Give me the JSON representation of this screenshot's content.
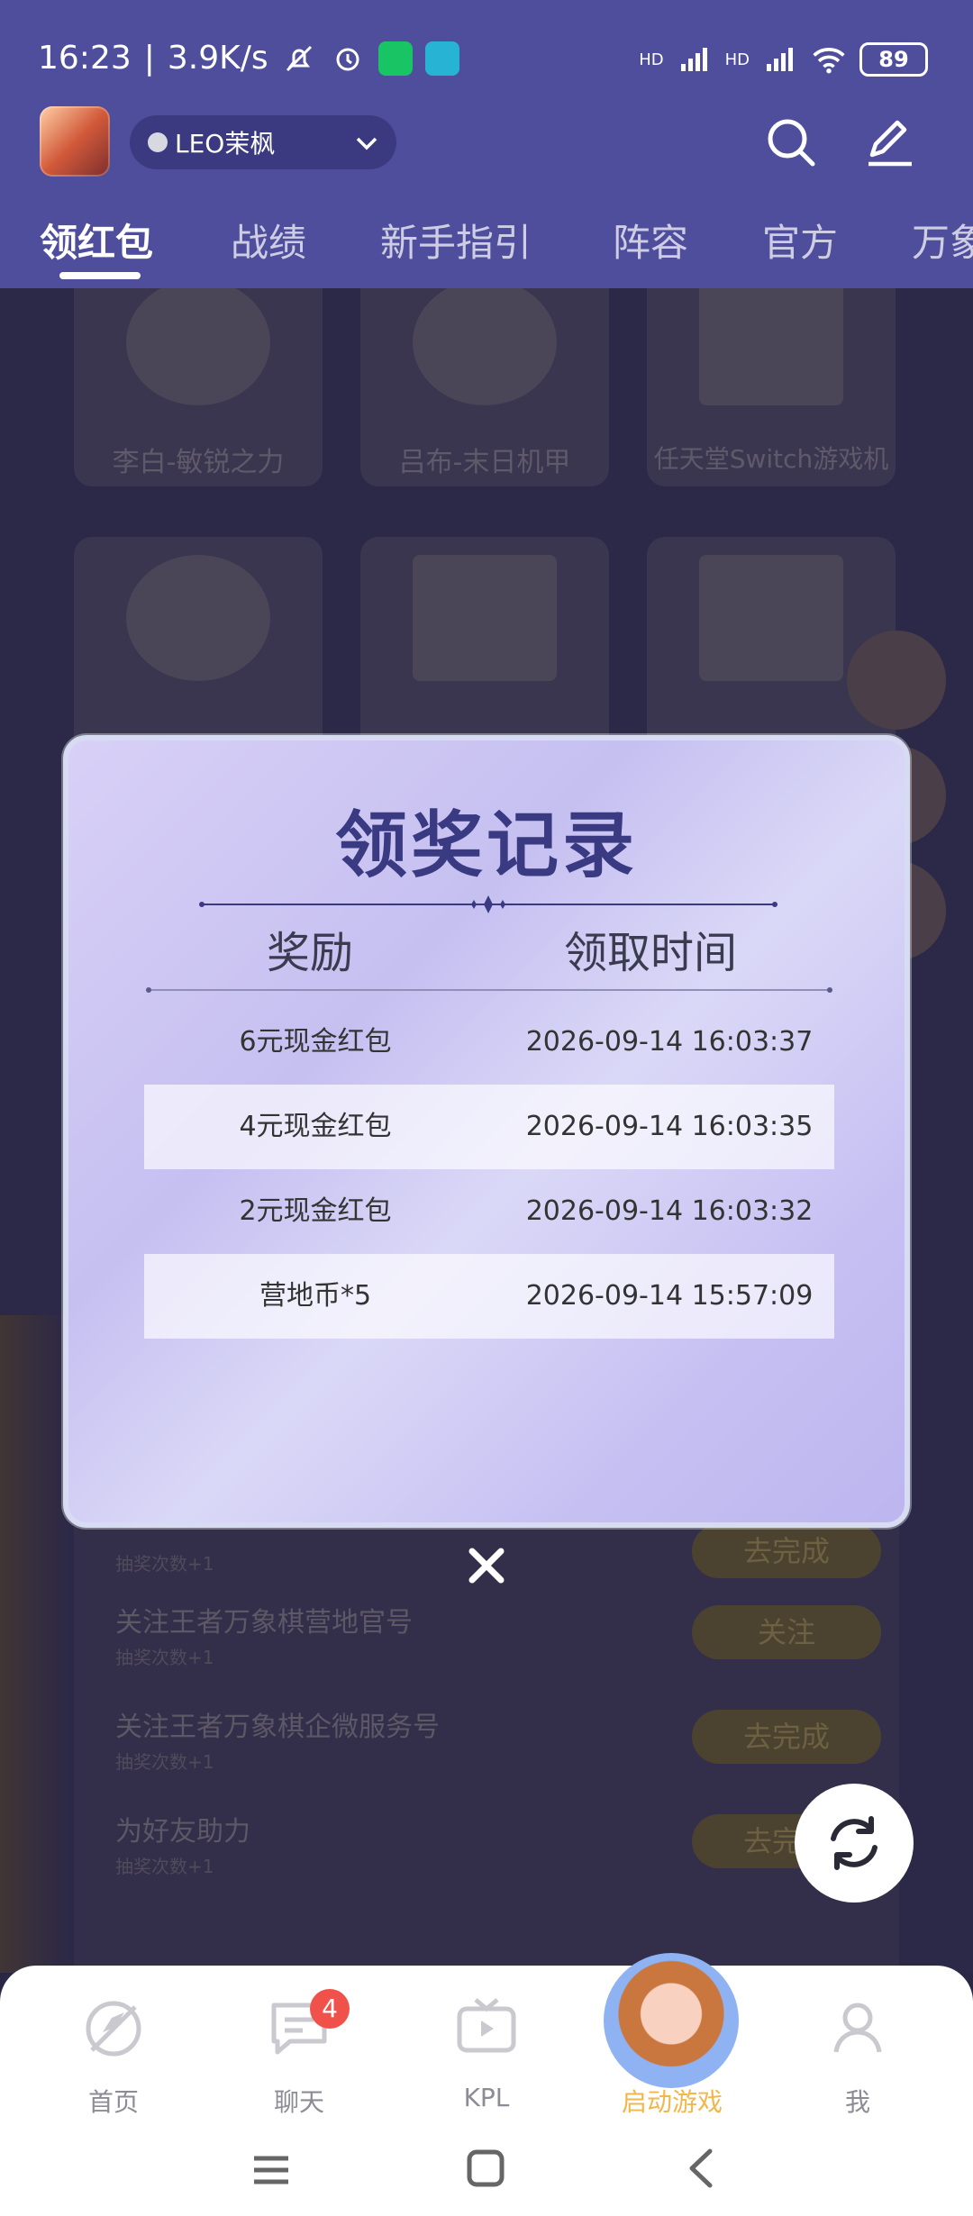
{
  "status_bar": {
    "time": "16:23",
    "network_speed": "3.9K/s",
    "battery": "89",
    "signal_label_1": "HD",
    "signal_label_2": "HD",
    "icons": [
      "mute-bell-icon",
      "alarm-icon",
      "wechat-icon",
      "telegram-icon",
      "signal-icon",
      "signal-icon",
      "wifi-icon",
      "battery-icon"
    ]
  },
  "app_bar": {
    "account_name": "LEO茉枫",
    "icons": [
      "search-icon",
      "edit-icon"
    ]
  },
  "tabs": [
    {
      "label": "领红包",
      "active": true
    },
    {
      "label": "战绩"
    },
    {
      "label": "新手指引"
    },
    {
      "label": "阵容"
    },
    {
      "label": "官方"
    },
    {
      "label": "万象"
    }
  ],
  "background": {
    "cards": [
      {
        "label": "李白-敏锐之力"
      },
      {
        "label": "吕布-末日机甲"
      },
      {
        "label": "任天堂Switch游戏机"
      }
    ],
    "tasks": [
      {
        "title": "",
        "sub": "抽奖次数+1",
        "button": "去完成"
      },
      {
        "title": "关注王者万象棋营地官号",
        "sub": "抽奖次数+1",
        "button": "关注"
      },
      {
        "title": "关注王者万象棋企微服务号",
        "sub": "抽奖次数+1",
        "button": "去完成"
      },
      {
        "title": "为好友助力",
        "sub": "抽奖次数+1",
        "button": "去完成"
      }
    ]
  },
  "modal": {
    "title": "领奖记录",
    "col_reward": "奖励",
    "col_time": "领取时间",
    "records": [
      {
        "reward": "6元现金红包",
        "time": "2026-09-14 16:03:37"
      },
      {
        "reward": "4元现金红包",
        "time": "2026-09-14 16:03:35"
      },
      {
        "reward": "2元现金红包",
        "time": "2026-09-14 16:03:32"
      },
      {
        "reward": "营地币*5",
        "time": "2026-09-14 15:57:09"
      }
    ]
  },
  "bottom_nav": {
    "items": [
      {
        "label": "首页"
      },
      {
        "label": "聊天",
        "badge": "4"
      },
      {
        "label": "KPL"
      },
      {
        "label": "启动游戏",
        "active": true
      },
      {
        "label": "我"
      }
    ]
  },
  "colors": {
    "header_bg": "#4f4e9c",
    "modal_title": "#3a3a82",
    "active_nav": "#f2b74a",
    "badge": "#f0524b"
  }
}
